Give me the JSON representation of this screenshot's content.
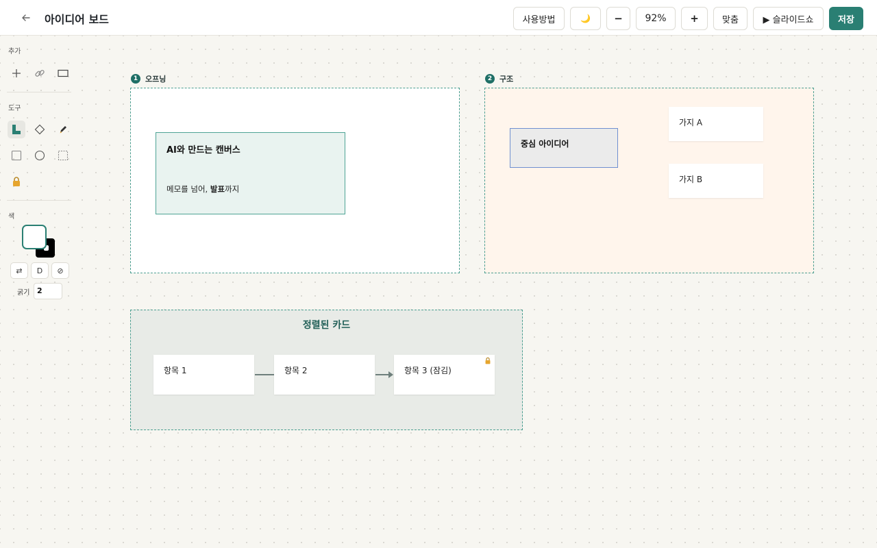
{
  "topbar": {
    "back_icon": "arrow-left-icon",
    "title": "아이디어 보드",
    "help_label": "사용방법",
    "theme_icon": "moon-icon",
    "theme_glyph": "🌙",
    "zoom_out_label": "−",
    "zoom_level": "92%",
    "zoom_in_label": "+",
    "fit_label": "맞춤",
    "slideshow_label": "▶ 슬라이드쇼",
    "save_label": "저장"
  },
  "sidebar": {
    "add_label": "추가",
    "add_tools": [
      "plus-icon",
      "link-icon",
      "rectangle-icon"
    ],
    "tools_label": "도구",
    "tools": [
      "connector-icon",
      "diamond-icon",
      "pen-icon",
      "square-icon",
      "circle-icon",
      "dashed-rectangle-icon",
      "lock-icon"
    ],
    "color_label": "색",
    "foreground_color": "#ffffff",
    "background_color": "#000000",
    "swap_label": "⇄",
    "default_label": "D",
    "none_label": "⊘",
    "stroke_label": "굵기",
    "stroke_value": "2"
  },
  "canvas": {
    "frames": [
      {
        "number": "1",
        "title": "오프닝"
      },
      {
        "number": "2",
        "title": "구조"
      },
      {
        "title": "정렬된 카드"
      }
    ],
    "opening_card": {
      "title": "AI와 만드는 캔버스",
      "body_prefix": "메모를 넘어, ",
      "body_bold": "발표",
      "body_suffix": "까지"
    },
    "structure": {
      "center": "중심 아이디어",
      "branch_a": "가지 A",
      "branch_b": "가지 B"
    },
    "cards": [
      "항목 1",
      "항목 2",
      "항목 3 (잠김)"
    ]
  },
  "colors": {
    "accent": "#2a7f73",
    "frame_border": "#4a9e90",
    "opening_card_bg": "#e9f3f0",
    "structure_bg": "#fff5ec",
    "sorted_frame_bg": "#e8ebe7",
    "center_node_bg": "#ebebeb",
    "center_node_border": "#6f8fd0"
  }
}
